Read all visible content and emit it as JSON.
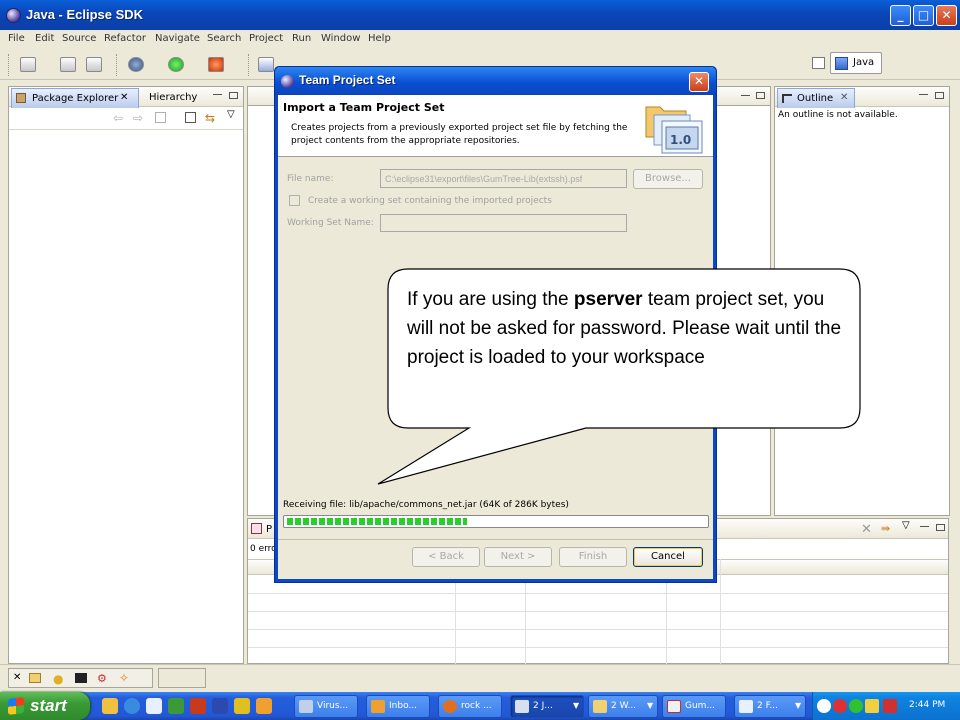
{
  "window": {
    "title": "Java - Eclipse SDK"
  },
  "menu": [
    "File",
    "Edit",
    "Source",
    "Refactor",
    "Navigate",
    "Search",
    "Project",
    "Run",
    "Window",
    "Help"
  ],
  "perspective": {
    "label": "Java"
  },
  "left_panel": {
    "tabs": [
      "Package Explorer",
      "Hierarchy"
    ]
  },
  "outline": {
    "tab": "Outline",
    "message": "An outline is not available."
  },
  "dialog": {
    "title": "Team Project Set",
    "heading": "Import a Team Project Set",
    "description": "Creates projects from a previously exported project set file by fetching the project contents from the appropriate repositories.",
    "badge": "1.0",
    "file_name_label": "File name:",
    "file_name_value": "C:\\eclipse31\\export\\files\\GumTree-Lib(extssh).psf",
    "browse_label": "Browse...",
    "working_set_checkbox": "Create a working set containing the imported projects",
    "working_set_name_label": "Working Set Name:",
    "progress_text": "Receiving file: lib/apache/commons_net.jar (64K of 286K bytes)",
    "progress_fraction": 0.43,
    "buttons": {
      "back": "< Back",
      "next": "Next >",
      "finish": "Finish",
      "cancel": "Cancel"
    }
  },
  "callout": {
    "before": "If you are using the ",
    "bold": "pserver",
    "after": " team project set, you will not be asked for password.  Please wait until the project is loaded to your workspace"
  },
  "problems": {
    "tab_initial": "P",
    "count_text": "0 erro"
  },
  "taskbar": {
    "start": "start",
    "buttons": [
      "Virus...",
      "Inbo...",
      "rock ...",
      "2 J...",
      "2 W...",
      "Gum...",
      "2 F..."
    ],
    "clock": "2:44 PM"
  }
}
